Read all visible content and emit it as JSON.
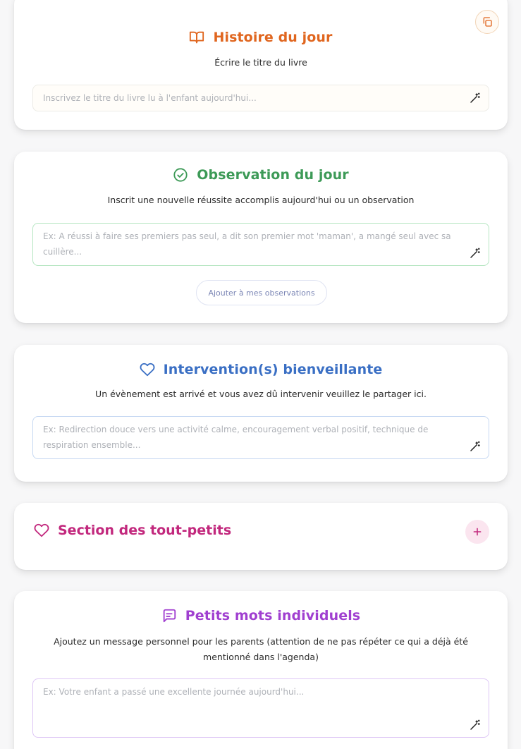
{
  "histoire": {
    "title": "Histoire du jour",
    "subtitle": "Écrire le titre du livre",
    "placeholder": "Inscrivez le titre du livre lu à l'enfant aujourd'hui...",
    "icon": "book-open-icon",
    "color": "#e0661f"
  },
  "observation": {
    "title": "Observation du jour",
    "subtitle": "Inscrit une nouvelle réussite accomplis aujourd'hui ou un observation",
    "placeholder": "Ex: A réussi à faire ses premiers pas seul, a dit son premier mot 'maman', a mangé seul avec sa cuillère...",
    "button_label": "Ajouter à mes observations",
    "icon": "check-circle-icon",
    "color": "#3d9a57"
  },
  "intervention": {
    "title": "Intervention(s) bienveillante",
    "subtitle": "Un évènement est arrivé et vous avez dû intervenir veuillez le partager ici.",
    "placeholder": "Ex: Redirection douce vers une activité calme, encouragement verbal positif, technique de respiration ensemble...",
    "icon": "heart-icon",
    "color": "#3a6fc4"
  },
  "tout_petits": {
    "title": "Section des tout-petits",
    "icon": "heart-icon",
    "color": "#c2287d"
  },
  "petits_mots": {
    "title": "Petits mots individuels",
    "subtitle": "Ajoutez un message personnel pour les parents (attention de ne pas répéter ce qui a déjà été mentionné dans l'agenda)",
    "placeholder": "Ex: Votre enfant a passé une excellente journée aujourd'hui...",
    "icon": "message-square-icon",
    "color": "#a03fd0"
  }
}
